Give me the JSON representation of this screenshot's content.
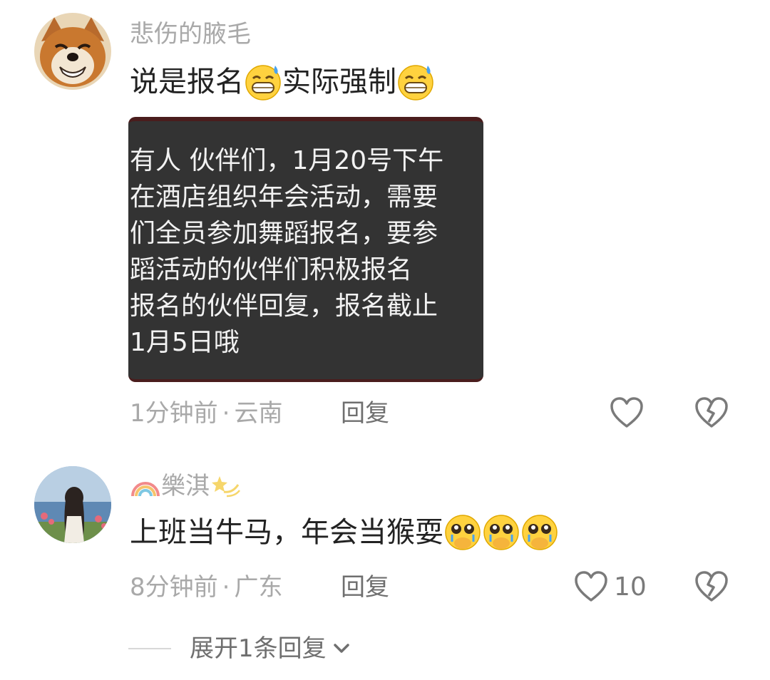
{
  "comments": [
    {
      "username": "悲伤的腋毛",
      "text_parts": [
        "说是报名",
        "实际强制"
      ],
      "emojis": [
        "sweat-smile-emoji",
        "sweat-smile-emoji"
      ],
      "image_lines": [
        "有人 伙伴们，1月20号下午",
        "在酒店组织年会活动，需要",
        "们全员参加舞蹈报名，要参",
        "蹈活动的伙伴们积极报名",
        "报名的伙伴回复，报名截止",
        "1月5日哦"
      ],
      "time": "1分钟前",
      "location": "云南",
      "reply_label": "回复",
      "likes": ""
    },
    {
      "username": "樂淇",
      "text": "上班当牛马，年会当猴耍",
      "emojis": [
        "pleading-cry-emoji",
        "pleading-cry-emoji",
        "pleading-cry-emoji"
      ],
      "time": "8分钟前",
      "location": "广东",
      "reply_label": "回复",
      "likes": "10"
    }
  ],
  "separator": "·",
  "expand_label": "展开1条回复",
  "colors": {
    "meta_gray": "#a9a9a9",
    "text_dark": "#222222",
    "icon_gray": "#7a7a7a"
  }
}
